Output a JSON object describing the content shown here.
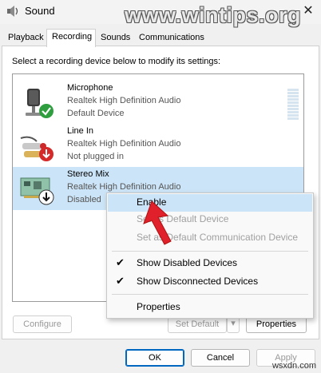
{
  "window": {
    "title": "Sound",
    "watermark": "www.wintips.org"
  },
  "tabs": [
    {
      "label": "Playback"
    },
    {
      "label": "Recording"
    },
    {
      "label": "Sounds"
    },
    {
      "label": "Communications"
    }
  ],
  "instruction": "Select a recording device below to modify its settings:",
  "devices": [
    {
      "name": "Microphone",
      "driver": "Realtek High Definition Audio",
      "status": "Default Device",
      "icon": "microphone-icon",
      "badge": "green-check-icon"
    },
    {
      "name": "Line In",
      "driver": "Realtek High Definition Audio",
      "status": "Not plugged in",
      "icon": "line-in-jack-icon",
      "badge": "red-down-arrow-icon"
    },
    {
      "name": "Stereo Mix",
      "driver": "Realtek High Definition Audio",
      "status": "Disabled",
      "icon": "sound-card-icon",
      "badge": "black-down-arrow-icon"
    }
  ],
  "context_menu": {
    "items": [
      {
        "label": "Enable"
      },
      {
        "label": "Set as Default Device"
      },
      {
        "label": "Set as Default Communication Device"
      },
      {
        "label": "Show Disabled Devices"
      },
      {
        "label": "Show Disconnected Devices"
      },
      {
        "label": "Properties"
      }
    ]
  },
  "buttons": {
    "configure": "Configure",
    "set_default": "Set Default",
    "properties": "Properties",
    "ok": "OK",
    "cancel": "Cancel",
    "apply": "Apply"
  },
  "site_watermark": "wsxdn.com",
  "colors": {
    "selection": "#cce4f7",
    "accent": "#0067c0",
    "arrow": "#e0202a"
  }
}
